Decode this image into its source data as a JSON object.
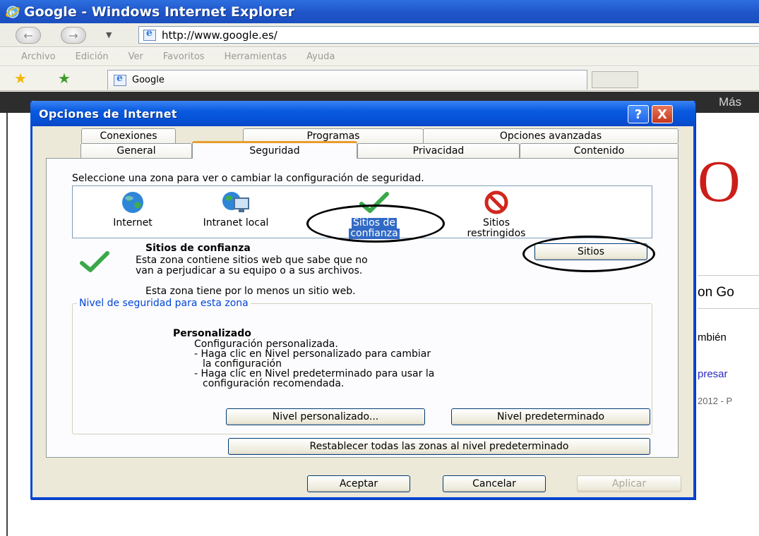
{
  "window": {
    "title": "Google - Windows Internet Explorer"
  },
  "address": {
    "url": "http://www.google.es/"
  },
  "menu": [
    "Archivo",
    "Edición",
    "Ver",
    "Favoritos",
    "Herramientas",
    "Ayuda"
  ],
  "tabs_bar": {
    "active_tab": "Google"
  },
  "background_page": {
    "more_link": "Más",
    "partial_texts": [
      "on Go",
      "mbién",
      "presar",
      "2012 - P"
    ]
  },
  "dialog": {
    "title": "Opciones de Internet",
    "help_label": "?",
    "close_label": "X",
    "tabs_row1": [
      "Conexiones",
      "Programas",
      "Opciones avanzadas"
    ],
    "tabs_row2": [
      "General",
      "Seguridad",
      "Privacidad",
      "Contenido"
    ],
    "active_tab": "Seguridad",
    "zone_prompt": "Seleccione una zona para ver o cambiar la configuración de seguridad.",
    "zones": [
      {
        "line1": "Internet",
        "line2": "",
        "icon": "globe-icon"
      },
      {
        "line1": "Intranet local",
        "line2": "",
        "icon": "intranet-icon"
      },
      {
        "line1": "Sitios de",
        "line2": "confianza",
        "icon": "checkmark-icon",
        "selected": true
      },
      {
        "line1": "Sitios",
        "line2": "restringidos",
        "icon": "restricted-icon"
      }
    ],
    "zone_title": "Sitios de confianza",
    "zone_desc_1": "Esta zona contiene sitios web que sabe que no",
    "zone_desc_2": "van a perjudicar a su equipo o a sus archivos.",
    "sites_button": "Sitios",
    "zone_count": "Esta zona tiene por lo menos un sitio web.",
    "group_legend": "Nivel de seguridad para esta zona",
    "level_title": "Personalizado",
    "level_lines": [
      "Configuración personalizada.",
      "- Haga clic en Nivel personalizado para cambiar",
      "la configuración",
      "- Haga clic en Nivel predeterminado para usar la",
      "configuración recomendada."
    ],
    "custom_level_button": "Nivel personalizado...",
    "default_level_button": "Nivel predeterminado",
    "reset_button": "Restablecer todas las zonas al nivel predeterminado",
    "ok_button": "Aceptar",
    "cancel_button": "Cancelar",
    "apply_button": "Aplicar"
  }
}
